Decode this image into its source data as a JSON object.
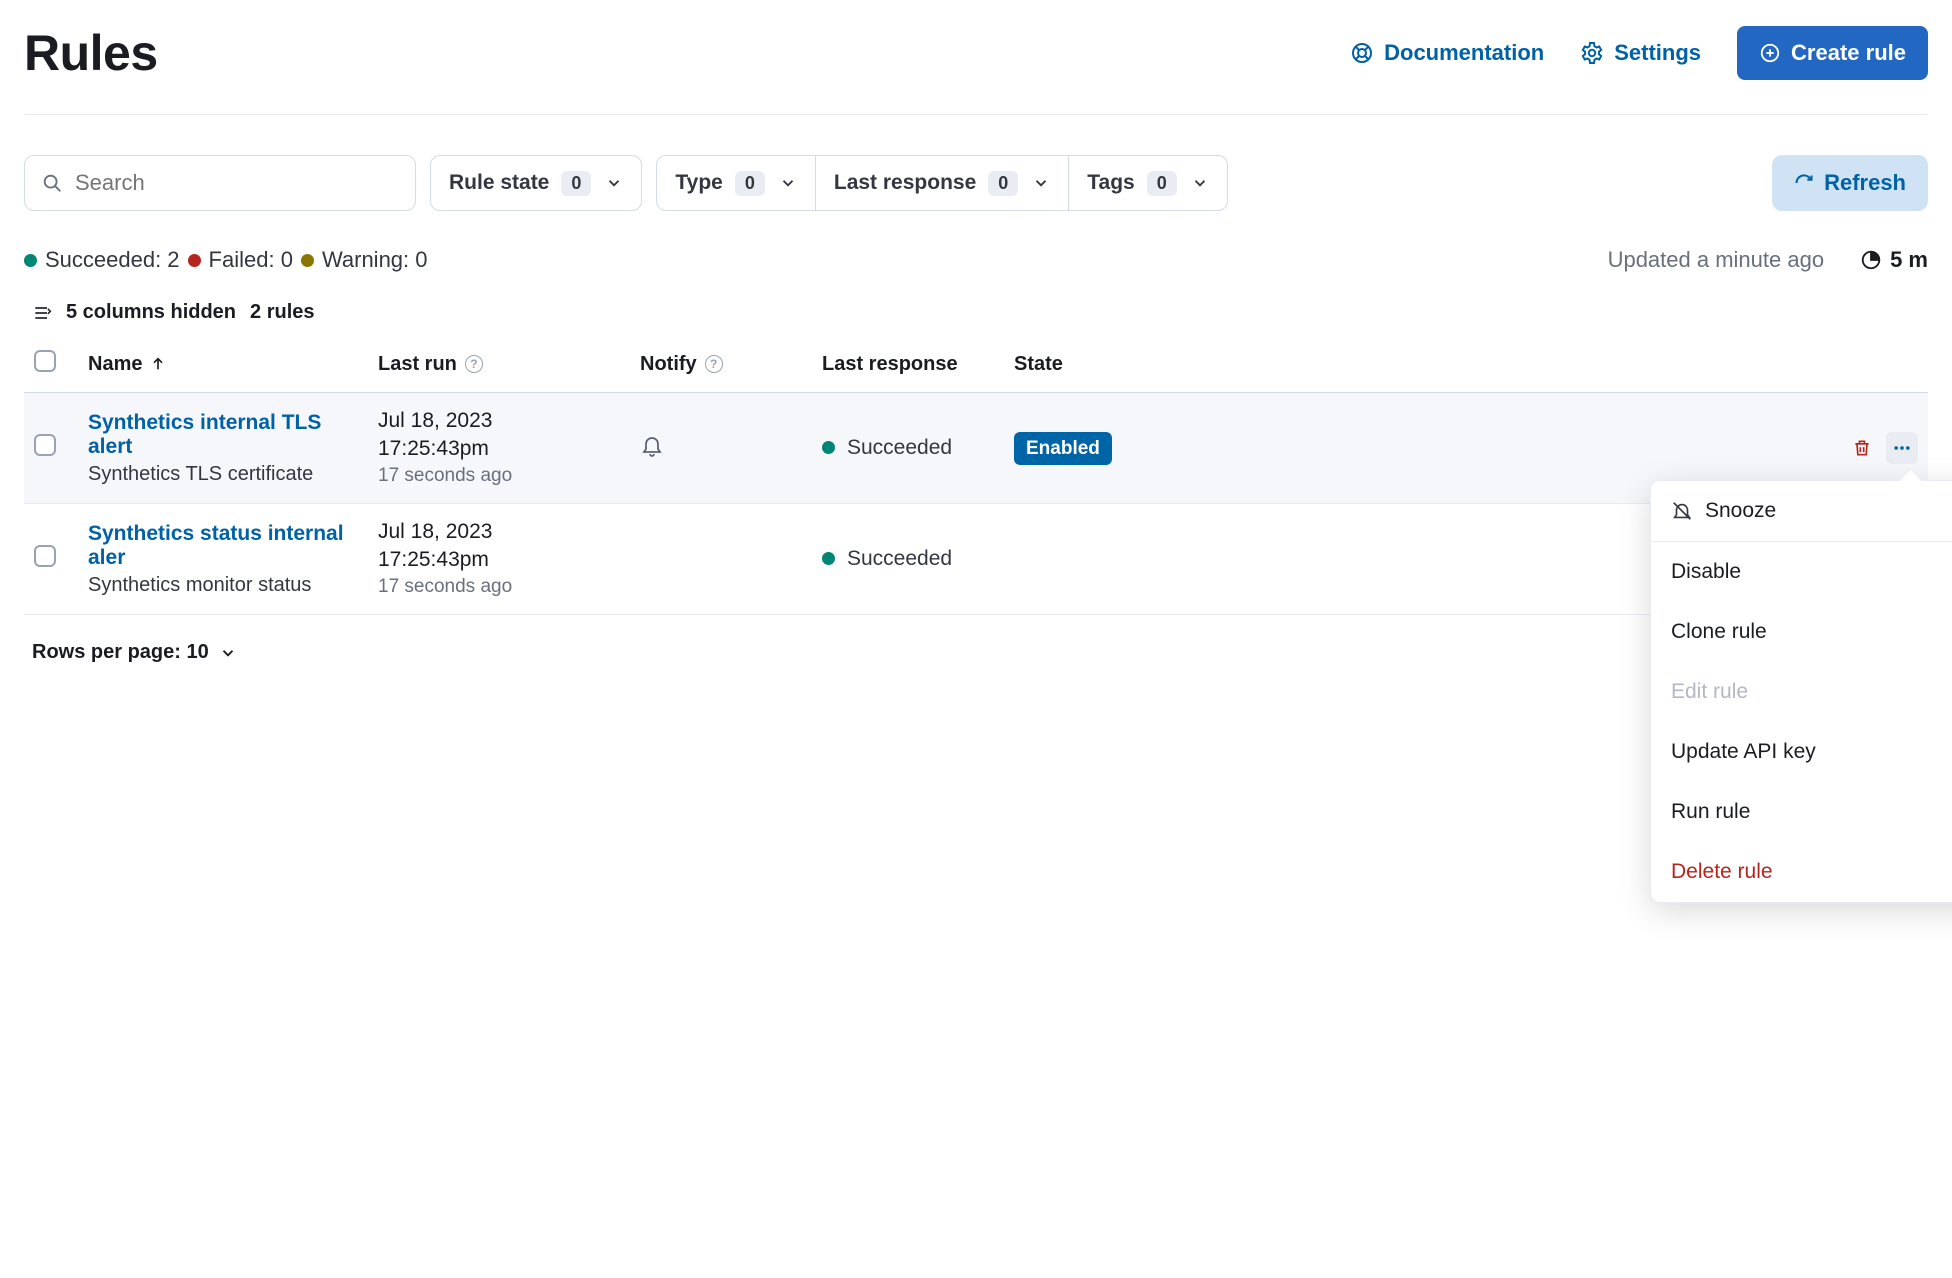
{
  "header": {
    "title": "Rules",
    "documentation_label": "Documentation",
    "settings_label": "Settings",
    "create_rule_label": "Create rule"
  },
  "search": {
    "placeholder": "Search"
  },
  "filters": {
    "rule_state": {
      "label": "Rule state",
      "count": "0"
    },
    "type": {
      "label": "Type",
      "count": "0"
    },
    "last_response": {
      "label": "Last response",
      "count": "0"
    },
    "tags": {
      "label": "Tags",
      "count": "0"
    }
  },
  "refresh_label": "Refresh",
  "status": {
    "succeeded_label": "Succeeded: 2",
    "failed_label": "Failed: 0",
    "warning_label": "Warning: 0",
    "updated_label": "Updated a minute ago",
    "interval_label": "5 m",
    "colors": {
      "succeeded": "#008676",
      "failed": "#b4251d",
      "warning": "#8a7500"
    }
  },
  "meta": {
    "columns_hidden_label": "5 columns hidden",
    "rules_count_label": "2 rules"
  },
  "columns": {
    "name": "Name",
    "last_run": "Last run",
    "notify": "Notify",
    "last_response": "Last response",
    "state": "State"
  },
  "rows": [
    {
      "name": "Synthetics internal TLS alert",
      "subtitle": "Synthetics TLS certificate",
      "run_date": "Jul 18, 2023",
      "run_time": "17:25:43pm",
      "run_ago": "17 seconds ago",
      "notify_icon": "bell",
      "response": "Succeeded",
      "state": "Enabled",
      "selected": true
    },
    {
      "name": "Synthetics status internal aler",
      "subtitle": "Synthetics monitor status",
      "run_date": "Jul 18, 2023",
      "run_time": "17:25:43pm",
      "run_ago": "17 seconds ago",
      "notify_icon": "",
      "response": "Succeeded",
      "state": "",
      "selected": false
    }
  ],
  "pager": {
    "label": "Rows per page: 10"
  },
  "popover": {
    "snooze": "Snooze",
    "disable": "Disable",
    "clone": "Clone rule",
    "edit": "Edit rule",
    "update_key": "Update API key",
    "run": "Run rule",
    "delete": "Delete rule"
  }
}
